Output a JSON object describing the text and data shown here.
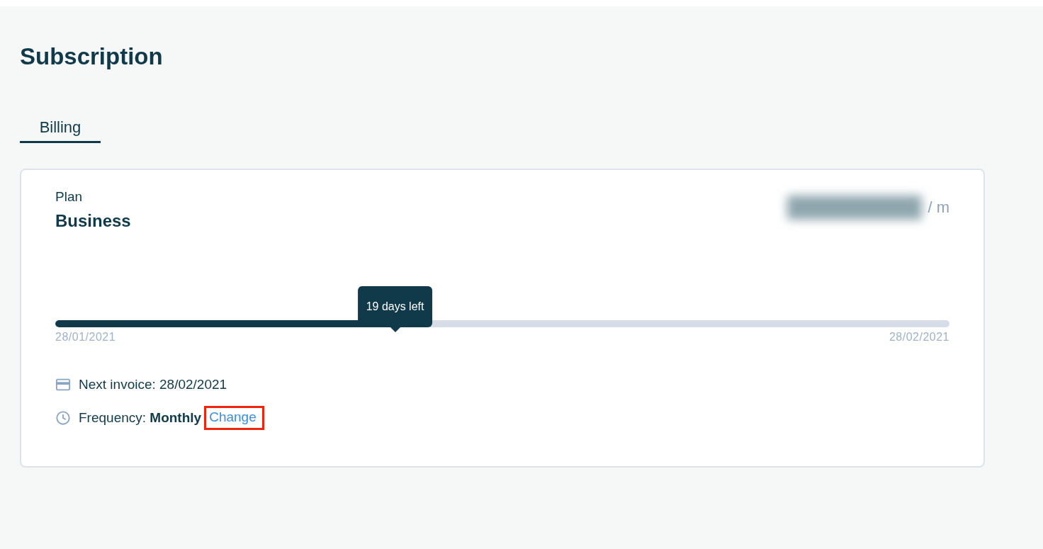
{
  "page": {
    "title": "Subscription"
  },
  "tabs": [
    {
      "label": "Billing",
      "selected": true
    }
  ],
  "plan": {
    "label": "Plan",
    "name": "Business",
    "price_unit": "/ m",
    "price_redacted": true,
    "progress": {
      "level": 0.38,
      "tooltip": "19 days left",
      "start_date": "28/01/2021",
      "end_date": "28/02/2021"
    },
    "details": [
      {
        "kind": "invoice",
        "label": "Next invoice: 28/02/2021"
      },
      {
        "kind": "frequency",
        "label": "Frequency: **Monthly**",
        "link": {
          "label": "Change",
          "highlighted": true
        }
      }
    ]
  }
}
